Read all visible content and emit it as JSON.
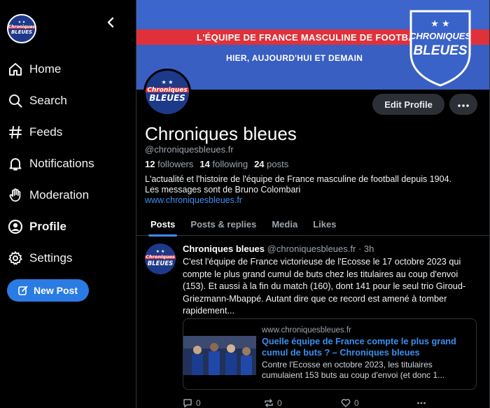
{
  "sidebar": {
    "logo_alt": "Chroniques bleues",
    "nav": [
      {
        "label": "Home",
        "icon": "home-icon"
      },
      {
        "label": "Search",
        "icon": "search-icon"
      },
      {
        "label": "Feeds",
        "icon": "hash-icon"
      },
      {
        "label": "Notifications",
        "icon": "bell-icon"
      },
      {
        "label": "Moderation",
        "icon": "hand-icon"
      },
      {
        "label": "Profile",
        "icon": "profile-icon",
        "active": true
      },
      {
        "label": "Settings",
        "icon": "gear-icon"
      }
    ],
    "new_post_label": "New Post"
  },
  "banner": {
    "line1": "L'ÉQUIPE DE FRANCE MASCULINE DE FOOTBALL",
    "line2": "HIER, AUJOURD'HUI ET DEMAIN",
    "logo_line1": "CHRONIQUES",
    "logo_line2": "BLEUES"
  },
  "profile": {
    "edit_label": "Edit Profile",
    "display_name": "Chroniques bleues",
    "handle": "@chroniquesbleues.fr",
    "followers_count": "12",
    "followers_label": "followers",
    "following_count": "14",
    "following_label": "following",
    "posts_count": "24",
    "posts_label": "posts",
    "bio_line1": "L'actualité et l'histoire de l'équipe de France masculine de football depuis 1904.",
    "bio_line2": "Les messages sont de Bruno Colombari",
    "link": "www.chroniquesbleues.fr"
  },
  "tabs": [
    "Posts",
    "Posts & replies",
    "Media",
    "Likes"
  ],
  "post": {
    "name": "Chroniques bleues",
    "handle": "@chroniquesbleues.fr",
    "time": "· 3h",
    "text": "C'est l'équipe de France victorieuse de l'Ecosse le 17 octobre 2023 qui compte le plus grand cumul de buts chez les titulaires au coup d'envoi (153). Et aussi à la fin du match (160), dont 141 pour le seul trio Giroud-Griezmann-Mbappé. Autant dire que ce record est amené à tomber rapidement...",
    "card": {
      "domain": "www.chroniquesbleues.fr",
      "title": "Quelle équipe de France compte le plus grand cumul de buts ? – Chroniques bleues",
      "description": "Contre l'Ecosse en octobre 2023, les titulaires cumulaient 153 buts au coup d'envoi (et donc 1..."
    },
    "replies": "0",
    "reposts": "0",
    "likes": "0"
  },
  "colors": {
    "accent": "#3b8ff0",
    "button_blue": "#2a7be4",
    "banner_blue": "#3a63c9",
    "banner_red": "#e0313a"
  }
}
